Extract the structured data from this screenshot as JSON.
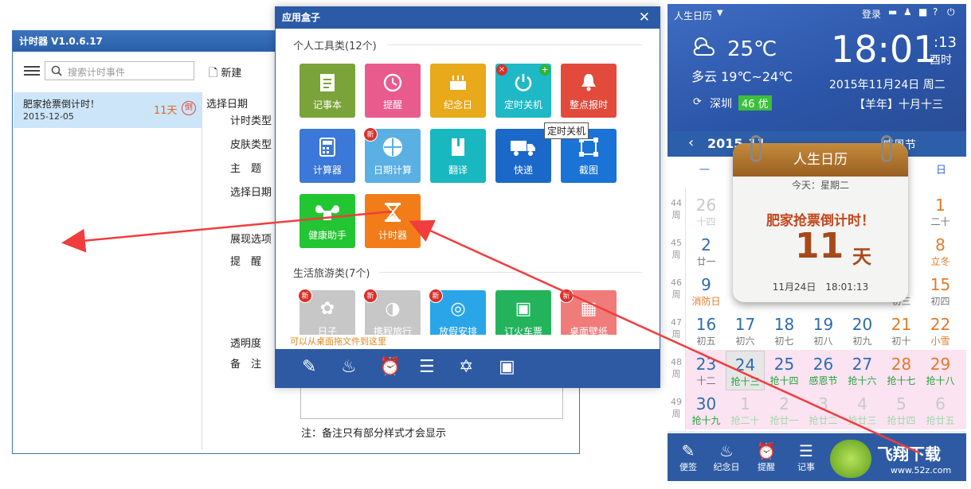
{
  "timer": {
    "title": "计时器 V1.0.6.17",
    "search_placeholder": "搜索计时事件",
    "new_label": "新建",
    "item": {
      "name": "肥家抢票倒计时！",
      "days": "11天",
      "badge": "倒",
      "date": "2015-12-05"
    },
    "labels": {
      "select_date_header": "选择日期",
      "timer_type": "计时类型",
      "skin_type": "皮肤类型",
      "theme": "主　题",
      "select_date": "选择日期",
      "display_options": "展现选项",
      "reminder": "提　醒",
      "opacity": "透明度",
      "notes": "备　注"
    },
    "note_hint": "注：备注只有部分样式才会显示"
  },
  "appbox": {
    "title": "应用盒子",
    "close": "✕",
    "section1": "个人工具类(12个)",
    "section2": "生活旅游类(7个)",
    "tiles1": [
      {
        "label": "记事本",
        "color": "#7aa33a",
        "icon": "notepad-icon"
      },
      {
        "label": "提醒",
        "color": "#ea5b8d",
        "icon": "alarm-icon"
      },
      {
        "label": "纪念日",
        "color": "#e8a91a",
        "icon": "cake-icon"
      },
      {
        "label": "定时关机",
        "color": "#1fb8c7",
        "icon": "power-icon"
      },
      {
        "label": "整点报时",
        "color": "#e24a3b",
        "icon": "bell-icon"
      },
      {
        "label": "计算器",
        "color": "#3c78d8",
        "icon": "calculator-icon"
      },
      {
        "label": "日期计算",
        "color": "#5ab0e2",
        "icon": "date-calc-icon"
      },
      {
        "label": "翻译",
        "color": "#19b7bf",
        "icon": "book-icon"
      },
      {
        "label": "快递",
        "color": "#1a69c9",
        "icon": "truck-icon"
      },
      {
        "label": "截图",
        "color": "#1b73d6",
        "icon": "crop-icon"
      },
      {
        "label": "健康助手",
        "color": "#22c532",
        "icon": "muscle-icon"
      },
      {
        "label": "计时器",
        "color": "#f27c18",
        "icon": "hourglass-icon"
      }
    ],
    "tiles2": [
      {
        "label": "日子",
        "color": "#c7c7c7",
        "icon": "clover-icon"
      },
      {
        "label": "携程旅行",
        "color": "#c7c7c7",
        "icon": "dolphin-icon"
      },
      {
        "label": "放假安排",
        "color": "#2aa6e8",
        "icon": "holiday-icon"
      },
      {
        "label": "订火车票",
        "color": "#22b35c",
        "icon": "train-icon"
      },
      {
        "label": "桌面壁纸",
        "color": "#f07b7b",
        "icon": "wallpaper-icon"
      }
    ],
    "new_badge": "新",
    "tooltip": "定时关机",
    "drag_hint": "可以从桌面拖文件到这里"
  },
  "calendar": {
    "app_name": "人生日历",
    "login": "登录",
    "temp": "25℃",
    "weather": "多云 19℃~24℃",
    "time": "18:01",
    "seconds": ":13",
    "shichen": "酉时",
    "date": "2015年11月24日 周二",
    "city": "深圳",
    "aqi": "46 优",
    "lunar": "【羊年】十月十三",
    "month_nav": "2015-11",
    "festival": "感恩节",
    "weekday_mon": "一",
    "weekday_sun": "日",
    "popup": {
      "title": "人生日历",
      "today": "今天：星期二",
      "event": "肥家抢票倒计时！",
      "days": "11",
      "unit": "天",
      "stamp": "11月24日　18:01:13"
    },
    "weeks": [
      "44\n周",
      "45\n周",
      "46\n周",
      "47\n周",
      "48\n周",
      "49\n周"
    ],
    "rows": [
      [
        [
          "26",
          "十四"
        ],
        [
          "",
          ""
        ],
        [
          "",
          ""
        ],
        [
          "",
          ""
        ],
        [
          "",
          ""
        ],
        [
          "",
          ""
        ],
        [
          "1",
          "二十"
        ]
      ],
      [
        [
          "2",
          "廿一"
        ],
        [
          "",
          ""
        ],
        [
          "",
          ""
        ],
        [
          "",
          ""
        ],
        [
          "",
          ""
        ],
        [
          "",
          ""
        ],
        [
          "8",
          "立冬"
        ]
      ],
      [
        [
          "9",
          "消防日"
        ],
        [
          "",
          ""
        ],
        [
          "",
          ""
        ],
        [
          "",
          ""
        ],
        [
          "",
          ""
        ],
        [
          "4",
          "初三"
        ],
        [
          "15",
          "初四"
        ]
      ],
      [
        [
          "16",
          "初五"
        ],
        [
          "17",
          "初六"
        ],
        [
          "18",
          "初七"
        ],
        [
          "19",
          "初八"
        ],
        [
          "20",
          "初九"
        ],
        [
          "21",
          "初十"
        ],
        [
          "22",
          "小雪"
        ]
      ],
      [
        [
          "23",
          "十二"
        ],
        [
          "24",
          "抢十三"
        ],
        [
          "25",
          "抢十四"
        ],
        [
          "26",
          "感恩节"
        ],
        [
          "27",
          "抢十六"
        ],
        [
          "28",
          "抢十七"
        ],
        [
          "29",
          "抢十八"
        ]
      ],
      [
        [
          "30",
          "抢十九"
        ],
        [
          "1",
          "抢二十"
        ],
        [
          "2",
          "抢廿一"
        ],
        [
          "3",
          "抢廿二"
        ],
        [
          "4",
          "抢廿三"
        ],
        [
          "5",
          "抢廿四"
        ],
        [
          "6",
          "抢廿五"
        ]
      ]
    ],
    "footer": [
      "便签",
      "纪念日",
      "提醒",
      "记事"
    ],
    "watermark": "飞翔下载",
    "watermark_url": "www.52z.com"
  }
}
